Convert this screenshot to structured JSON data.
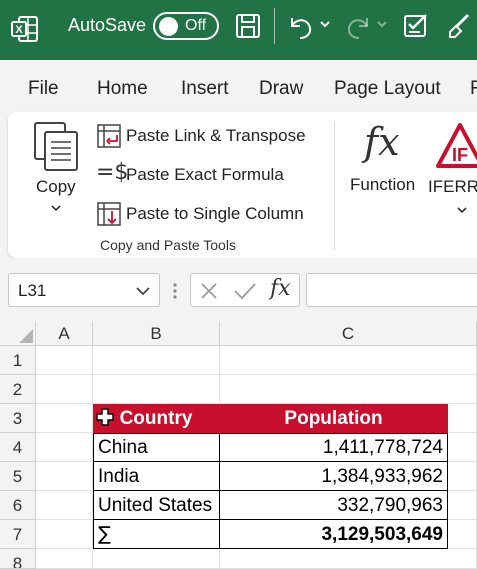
{
  "titlebar": {
    "autosave_label": "AutoSave",
    "autosave_state": "Off",
    "accent_color": "#217346"
  },
  "menu": {
    "items": [
      "File",
      "Home",
      "Insert",
      "Draw",
      "Page Layout",
      "F"
    ]
  },
  "ribbon": {
    "copy_label": "Copy",
    "commands": [
      "Paste Link & Transpose",
      "Paste Exact Formula",
      "Paste to Single Column"
    ],
    "group_title": "Copy and Paste Tools",
    "function_label": "Function",
    "iferror_label": "IFERRO"
  },
  "formula_bar": {
    "name_box": "L31",
    "formula": ""
  },
  "grid": {
    "columns": [
      "A",
      "B",
      "C"
    ],
    "rows": [
      "1",
      "2",
      "3",
      "4",
      "5",
      "6",
      "7",
      "8"
    ],
    "table": {
      "header": [
        "Country",
        "Population"
      ],
      "rows": [
        [
          "China",
          "1,411,778,724"
        ],
        [
          "India",
          "1,384,933,962"
        ],
        [
          "United States",
          "332,790,963"
        ]
      ],
      "total": [
        "∑",
        "3,129,503,649"
      ],
      "header_color": "#c8102e"
    }
  }
}
